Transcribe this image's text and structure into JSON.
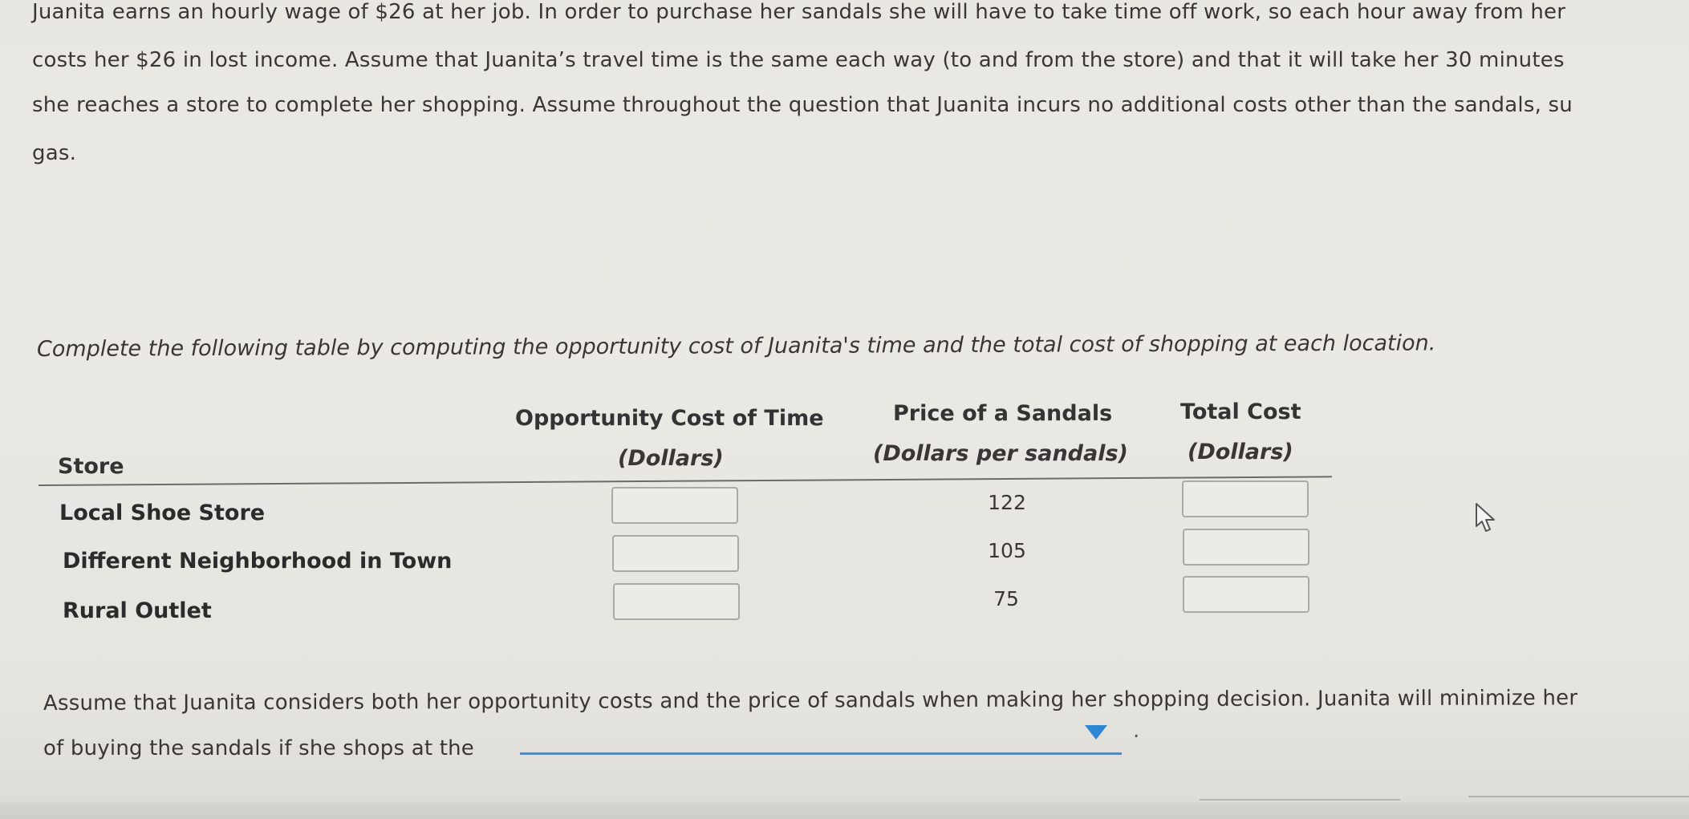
{
  "problem": {
    "paragraph_lines": [
      "Juanita earns an hourly wage of $26 at her job. In order to purchase her sandals she will have to take time off work, so each hour away from her",
      "costs her $26 in lost income. Assume that Juanita’s travel time is the same each way (to and from the store) and that it will take her 30 minutes",
      "she reaches a store to complete her shopping. Assume throughout the question that Juanita incurs no additional costs other than the sandals, su",
      "gas."
    ]
  },
  "instruction": "Complete the following table by computing the opportunity cost of Juanita's time and the total cost of shopping at each location.",
  "table": {
    "headers": {
      "store": "Store",
      "opportunity_cost": {
        "title": "Opportunity Cost of Time",
        "unit": "(Dollars)"
      },
      "price": {
        "title": "Price of a Sandals",
        "unit": "(Dollars per sandals)"
      },
      "total_cost": {
        "title": "Total Cost",
        "unit": "(Dollars)"
      }
    },
    "rows": [
      {
        "store": "Local Shoe Store",
        "opportunity_cost": "",
        "price": "122",
        "total_cost": ""
      },
      {
        "store": "Different Neighborhood in Town",
        "opportunity_cost": "",
        "price": "105",
        "total_cost": ""
      },
      {
        "store": "Rural Outlet",
        "opportunity_cost": "",
        "price": "75",
        "total_cost": ""
      }
    ]
  },
  "question": {
    "line1": "Assume that Juanita considers both her opportunity costs and the price of sandals when making her shopping decision. Juanita will minimize her",
    "line2_prefix": "of buying the sandals if she shops at the",
    "dropdown_selected": "",
    "suffix": "."
  },
  "colors": {
    "dropdown_accent": "#2f86d4",
    "dropdown_underline": "#5b86b8"
  }
}
